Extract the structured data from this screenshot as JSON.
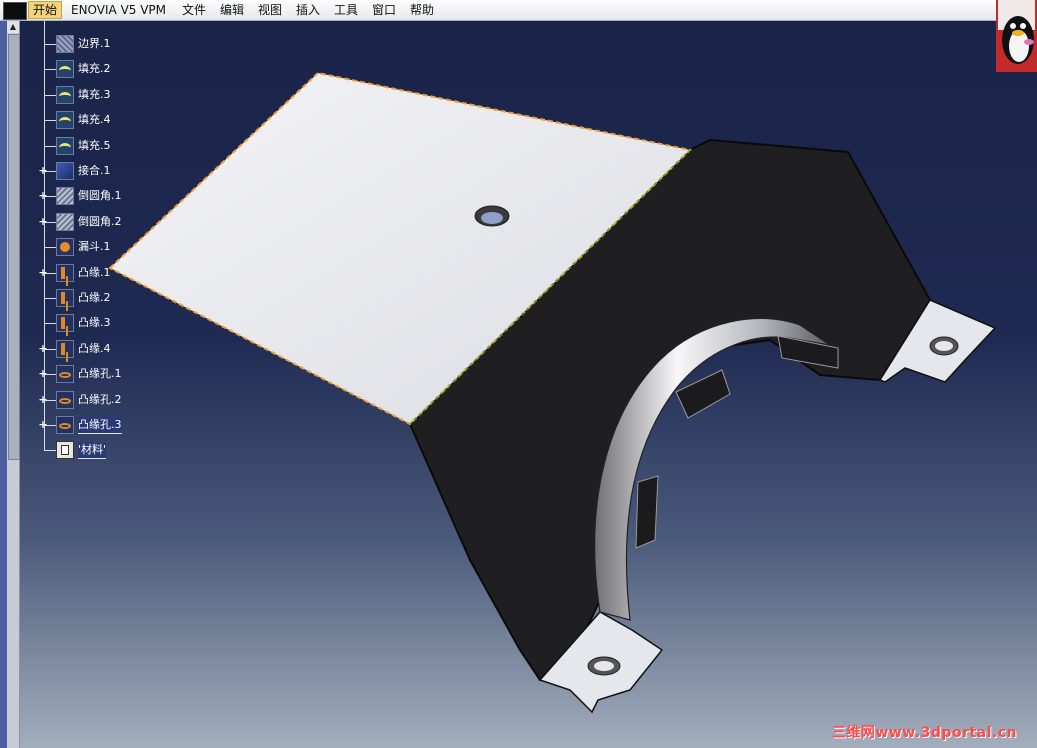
{
  "menubar": {
    "items": [
      "开始",
      "ENOVIA V5 VPM",
      "文件",
      "编辑",
      "视图",
      "插入",
      "工具",
      "窗口",
      "帮助"
    ]
  },
  "tree": {
    "nodes": [
      {
        "label": "边界.1",
        "icon": "boundary-icon",
        "expandable": false
      },
      {
        "label": "填充.2",
        "icon": "fill-icon",
        "expandable": false
      },
      {
        "label": "填充.3",
        "icon": "fill-icon",
        "expandable": false
      },
      {
        "label": "填充.4",
        "icon": "fill-icon",
        "expandable": false
      },
      {
        "label": "填充.5",
        "icon": "fill-icon",
        "expandable": false
      },
      {
        "label": "接合.1",
        "icon": "join-icon",
        "expandable": true
      },
      {
        "label": "倒圆角.1",
        "icon": "fillet-icon",
        "expandable": true
      },
      {
        "label": "倒圆角.2",
        "icon": "fillet-icon",
        "expandable": true
      },
      {
        "label": "漏斗.1",
        "icon": "funnel-icon",
        "expandable": false
      },
      {
        "label": "凸缘.1",
        "icon": "emboss-icon",
        "expandable": true
      },
      {
        "label": "凸缘.2",
        "icon": "emboss-icon",
        "expandable": false
      },
      {
        "label": "凸缘.3",
        "icon": "emboss-icon",
        "expandable": false
      },
      {
        "label": "凸缘.4",
        "icon": "emboss-icon",
        "expandable": true
      },
      {
        "label": "凸缘孔.1",
        "icon": "emboss-hole-icon",
        "expandable": true
      },
      {
        "label": "凸缘孔.2",
        "icon": "emboss-hole-icon",
        "expandable": true
      },
      {
        "label": "凸缘孔.3",
        "icon": "emboss-hole-icon",
        "expandable": true
      },
      {
        "label": "'材料'",
        "icon": "material-icon",
        "expandable": false
      }
    ]
  },
  "watermark": "三维网www.3dportal.cn",
  "colors": {
    "background_top": "#1a2347",
    "background_bottom": "#a3aebd",
    "part_light": "#ececf0",
    "part_dark": "#222222",
    "edge_highlight": "#f0a030"
  }
}
